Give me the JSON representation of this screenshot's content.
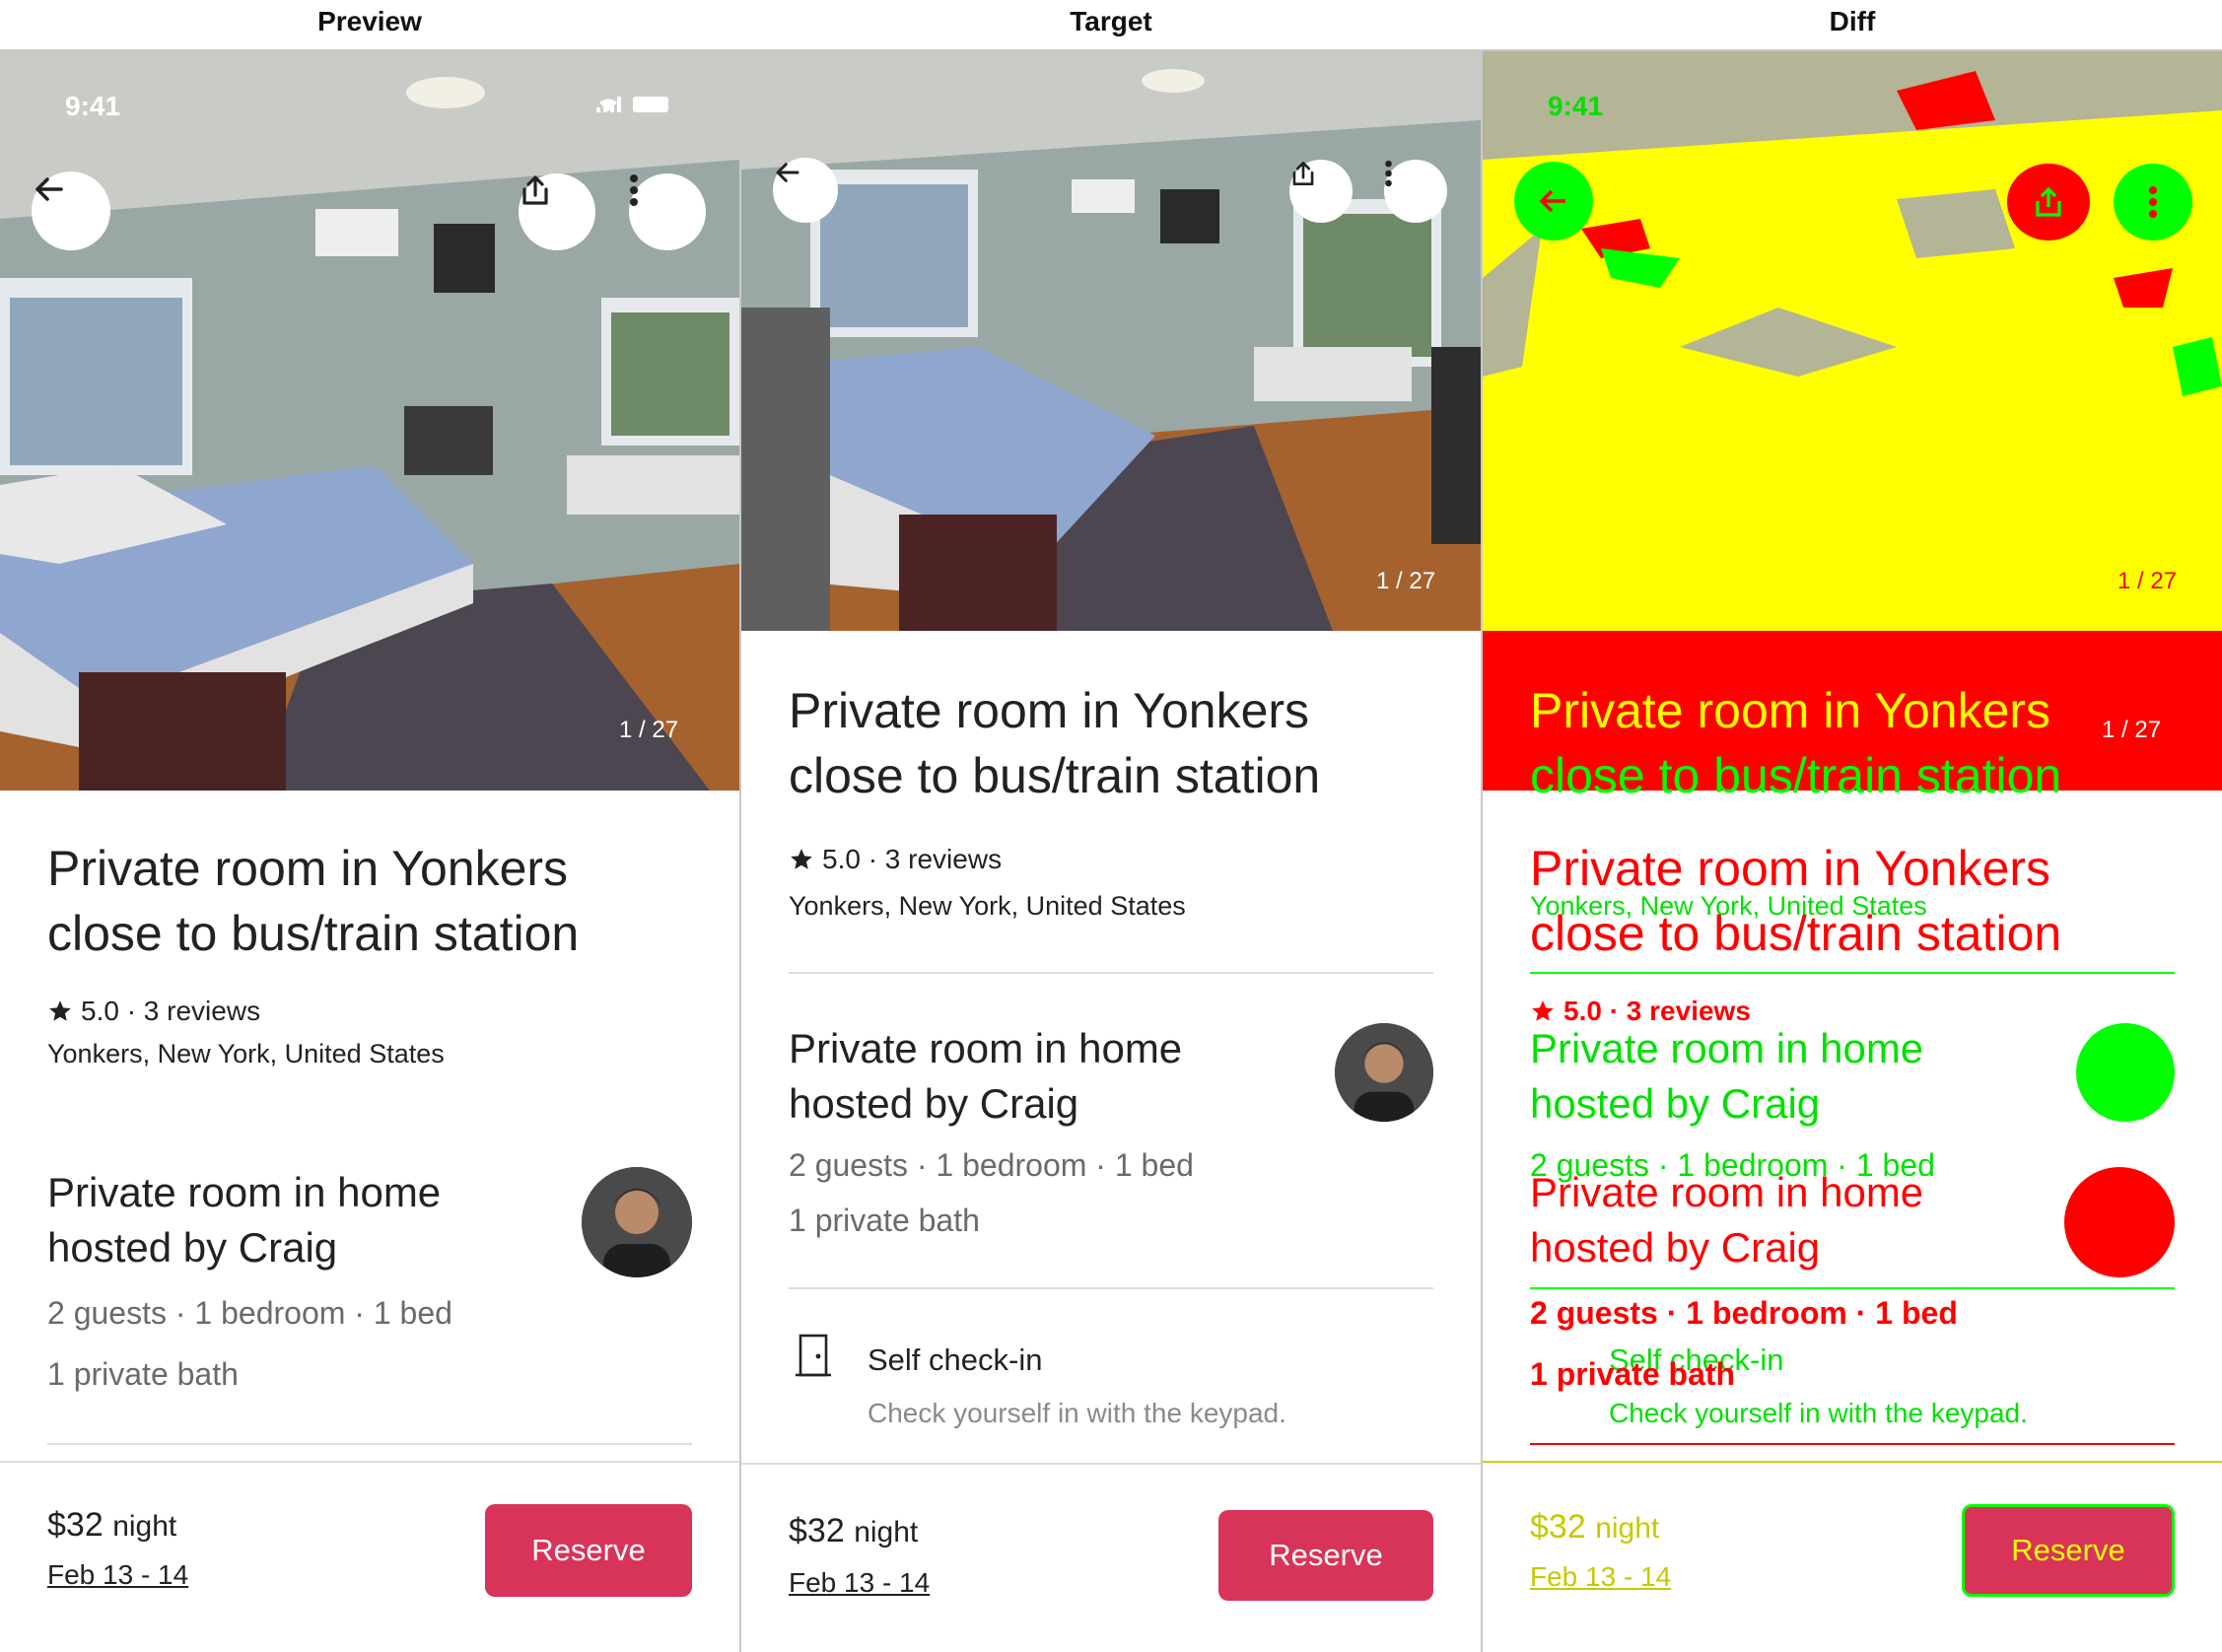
{
  "columns": {
    "preview": "Preview",
    "target": "Target",
    "diff": "Diff"
  },
  "status": {
    "time": "9:41"
  },
  "gallery": {
    "counter": "1 / 27"
  },
  "listing": {
    "title_line1": "Private room in Yonkers",
    "title_line2": "close to bus/train station",
    "rating": "5.0 · 3 reviews",
    "location": "Yonkers, New York, United States"
  },
  "host": {
    "title_line1": "Private room in home",
    "title_line2": "hosted by Craig",
    "capacity": "2 guests · 1 bedroom · 1 bed",
    "bath": "1 private bath"
  },
  "checkin": {
    "title": "Self check-in",
    "subtitle": "Check yourself in with the keypad."
  },
  "footer": {
    "price": "$32",
    "price_unit": "night",
    "dates": "Feb 13 - 14",
    "reserve_label": "Reserve"
  },
  "colors": {
    "brand": "#d83359",
    "diff_yellow": "#ffff00",
    "diff_red": "#ff0000",
    "diff_green": "#00ff00"
  },
  "icons": [
    "back-arrow-icon",
    "share-icon",
    "more-icon",
    "star-icon",
    "door-icon",
    "signal-icon",
    "wifi-icon",
    "battery-icon"
  ]
}
